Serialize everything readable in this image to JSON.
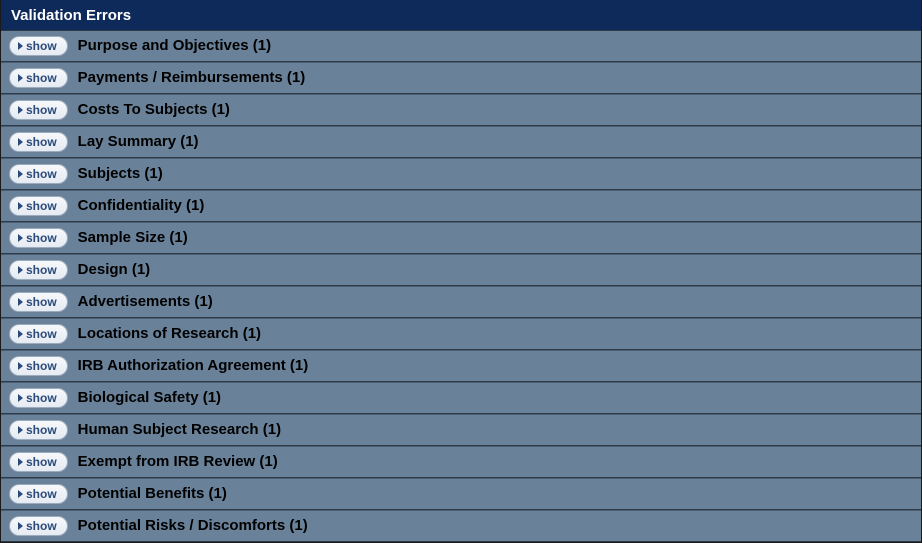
{
  "panel": {
    "title": "Validation Errors",
    "show_label": "show",
    "items": [
      {
        "label": "Purpose and Objectives (1)"
      },
      {
        "label": "Payments / Reimbursements (1)"
      },
      {
        "label": "Costs To Subjects (1)"
      },
      {
        "label": "Lay Summary (1)"
      },
      {
        "label": "Subjects (1)"
      },
      {
        "label": "Confidentiality (1)"
      },
      {
        "label": "Sample Size (1)"
      },
      {
        "label": "Design (1)"
      },
      {
        "label": "Advertisements (1)"
      },
      {
        "label": "Locations of Research (1)"
      },
      {
        "label": "IRB Authorization Agreement (1)"
      },
      {
        "label": "Biological Safety (1)"
      },
      {
        "label": "Human Subject Research (1)"
      },
      {
        "label": "Exempt from IRB Review (1)"
      },
      {
        "label": "Potential Benefits (1)"
      },
      {
        "label": "Potential Risks / Discomforts (1)"
      }
    ]
  }
}
